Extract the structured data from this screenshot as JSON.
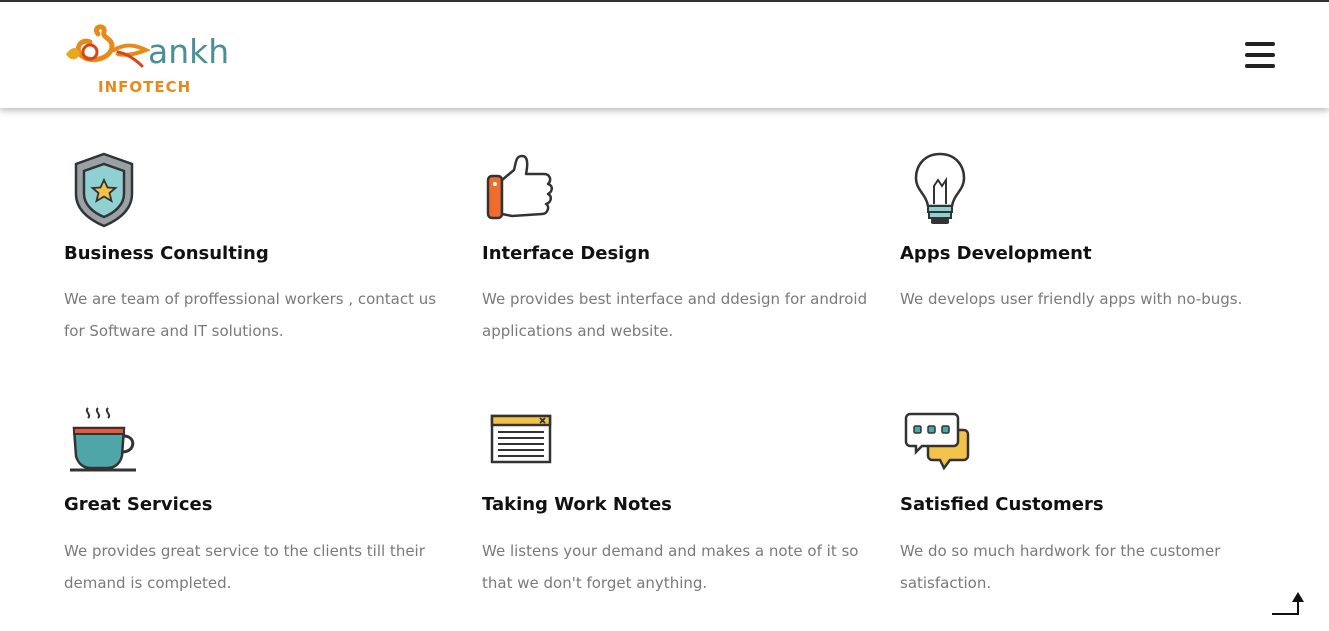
{
  "header": {
    "logo_text": "ankh",
    "logo_subtext": "INFOTECH",
    "menu_icon": "hamburger-menu-icon"
  },
  "services": [
    {
      "title": "Business Consulting",
      "description": "We are team of proffessional workers , contact us for Software and IT solutions.",
      "icon": "shield-star-icon"
    },
    {
      "title": "Interface Design",
      "description": "We provides best interface and ddesign for android applications and website.",
      "icon": "thumbs-up-icon"
    },
    {
      "title": "Apps Development",
      "description": "We develops user friendly apps with no-bugs.",
      "icon": "lightbulb-icon"
    },
    {
      "title": "Great Services",
      "description": "We provides great service to the clients till their demand is completed.",
      "icon": "coffee-cup-icon"
    },
    {
      "title": "Taking Work Notes",
      "description": "We listens your demand and makes a note of it so that we don't forget anything.",
      "icon": "notes-window-icon"
    },
    {
      "title": "Satisfied Customers",
      "description": "We do so much hardwork for the customer satisfaction.",
      "icon": "chat-bubbles-icon"
    }
  ],
  "scroll_top_icon": "scroll-to-top-icon"
}
